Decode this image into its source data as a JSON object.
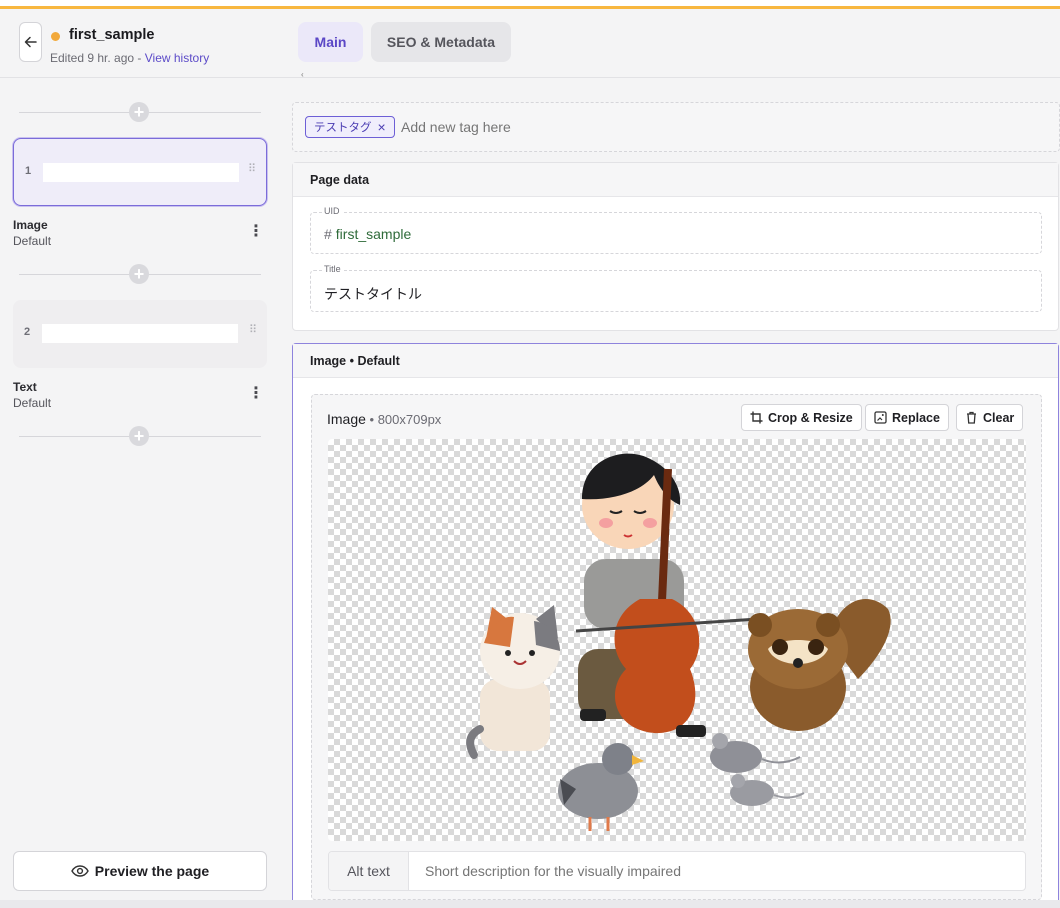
{
  "header": {
    "title": "first_sample",
    "status_color": "#f2a93b",
    "edited": "Edited 9 hr. ago - ",
    "history_link": "View history",
    "tabs": [
      {
        "label": "Main",
        "active": true
      },
      {
        "label": "SEO & Metadata",
        "active": false
      }
    ]
  },
  "sidebar": {
    "slices": [
      {
        "number": "1",
        "name": "Image",
        "variant": "Default",
        "active": true
      },
      {
        "number": "2",
        "name": "Text",
        "variant": "Default",
        "active": false
      }
    ],
    "preview_label": "Preview the page"
  },
  "tags": {
    "items": [
      "テストタグ"
    ],
    "placeholder": "Add new tag here"
  },
  "page_data": {
    "heading": "Page data",
    "uid_label": "UID",
    "uid_value": "first_sample",
    "title_label": "Title",
    "title_value": "テストタイトル"
  },
  "image_slice": {
    "heading": "Image • Default",
    "field_label": "Image",
    "dims": " • 800x709px",
    "buttons": {
      "crop": "Crop & Resize",
      "replace": "Replace",
      "clear": "Clear"
    },
    "alt_label": "Alt text",
    "alt_placeholder": "Short description for the visually impaired"
  },
  "colors": {
    "accent": "#5b47c6",
    "top_bar": "#f8b73f"
  }
}
